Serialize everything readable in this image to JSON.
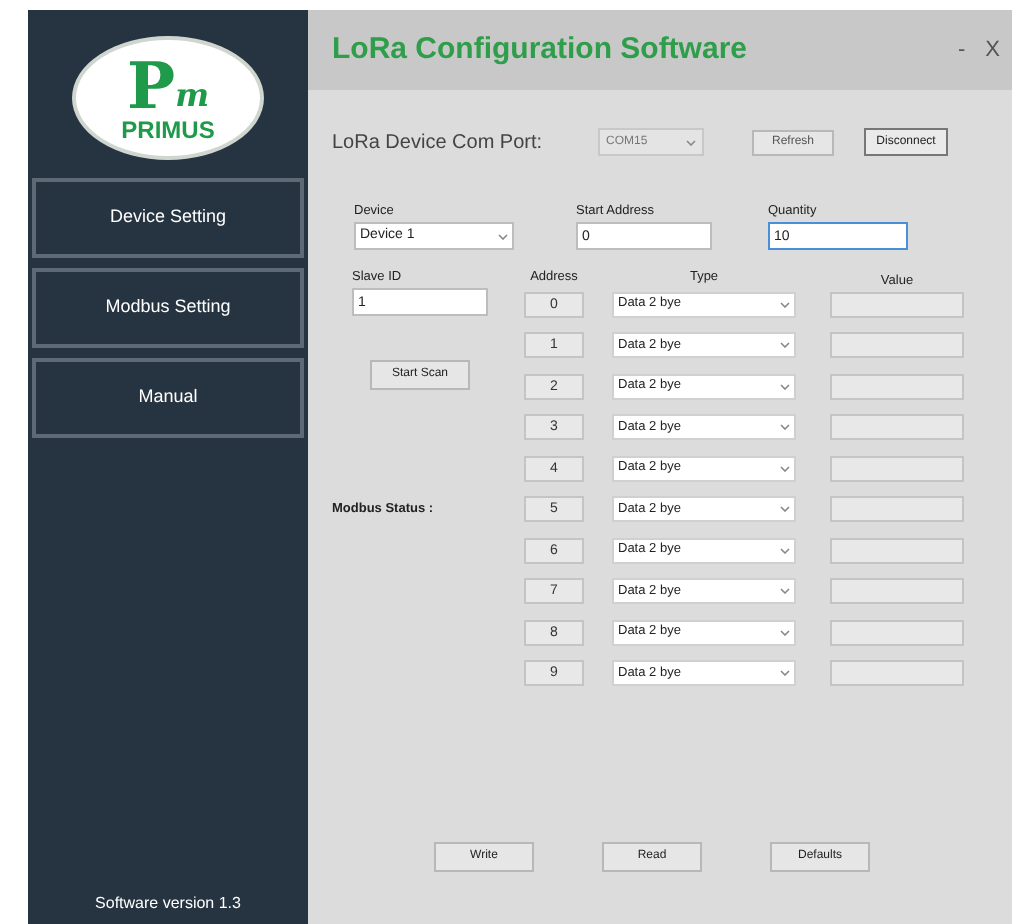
{
  "window": {
    "title": "LoRa Configuration Software",
    "controls": [
      "-",
      "X"
    ]
  },
  "sidebar": {
    "logo": {
      "letter": "P",
      "sub": "m",
      "name": "PRIMUS"
    },
    "items": [
      "Device Setting",
      "Modbus Setting",
      "Manual"
    ],
    "footer": "Software version 1.3"
  },
  "com_port": {
    "label": "LoRa Device Com Port:",
    "value": "COM15",
    "disabled": true,
    "buttons": [
      "Refresh",
      "Disconnect"
    ]
  },
  "device": {
    "label": "Device",
    "value": "Device 1"
  },
  "start_address": {
    "label": "Start Address",
    "value": "0",
    "focused": false
  },
  "quantity": {
    "label": "Quantity",
    "value": "10",
    "focused": true
  },
  "slave_id": {
    "label": "Slave ID",
    "value": "1",
    "focused": false
  },
  "scan_button": "Start Scan",
  "modbus_status": "Modbus Status :",
  "table": {
    "columns": [
      "Address",
      "Type",
      "Value"
    ],
    "rows": [
      {
        "address": "0",
        "type": "Data 2 bye"
      },
      {
        "address": "1",
        "type": "Data 2 bye"
      },
      {
        "address": "2",
        "type": "Data 2 bye"
      },
      {
        "address": "3",
        "type": "Data 2 bye"
      },
      {
        "address": "4",
        "type": "Data 2 bye"
      },
      {
        "address": "5",
        "type": "Data 2 bye"
      },
      {
        "address": "6",
        "type": "Data 2 bye"
      },
      {
        "address": "7",
        "type": "Data 2 bye"
      },
      {
        "address": "8",
        "type": "Data 2 bye"
      },
      {
        "address": "9",
        "type": "Data 2 bye"
      }
    ]
  },
  "buttons": [
    "Write",
    "Read",
    "Defaults"
  ]
}
